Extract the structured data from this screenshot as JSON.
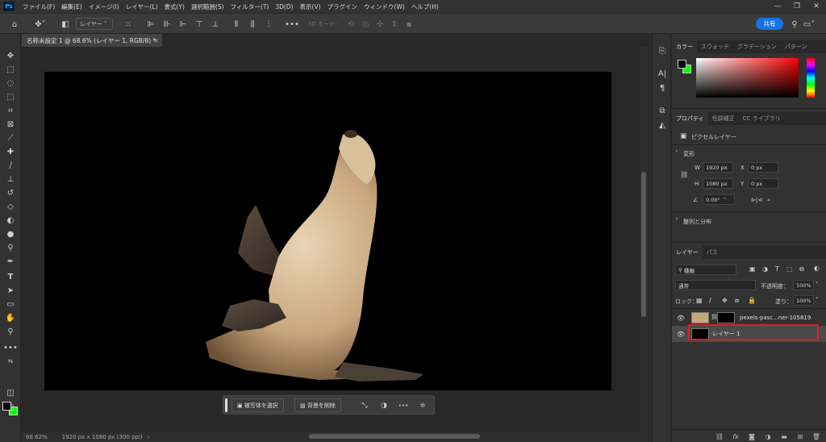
{
  "app": {
    "logo": "Ps"
  },
  "menu": [
    "ファイル(F)",
    "編集(E)",
    "イメージ(I)",
    "レイヤー(L)",
    "書式(Y)",
    "選択範囲(S)",
    "フィルター(T)",
    "3D(D)",
    "表示(V)",
    "プラグイン",
    "ウィンドウ(W)",
    "ヘルプ(H)"
  ],
  "options_bar": {
    "auto_select_value": "レイヤー",
    "mode_3d_label": "3D モード：",
    "share_label": "共有"
  },
  "document": {
    "tab_title": "名称未設定 1 @ 68.6% (レイヤー 1, RGB/8) *",
    "zoom": "68.62%",
    "info": "1920 px x 1080 px (300 ppi)"
  },
  "context_bar": {
    "select_subject": "被写体を選択",
    "remove_background": "背景を削除",
    "more": "•••"
  },
  "color_panel": {
    "tabs": [
      "カラー",
      "スウォッチ",
      "グラデーション",
      "パターン"
    ],
    "foreground": "#000000",
    "background": "#00ff00"
  },
  "properties_panel": {
    "tabs": [
      "プロパティ",
      "色調補正",
      "CC ライブラリ"
    ],
    "layer_type": "ピクセルレイヤー",
    "transform_label": "変形",
    "w_label": "W",
    "w_value": "1920 px",
    "h_label": "H",
    "h_value": "1080 px",
    "x_label": "X",
    "x_value": "0 px",
    "y_label": "Y",
    "y_value": "0 px",
    "angle_value": "0.00°",
    "align_label": "整列と分布"
  },
  "layers_panel": {
    "tabs": [
      "レイヤー",
      "パス"
    ],
    "filter_label": "種類",
    "blend_mode": "通常",
    "opacity_label": "不透明度：",
    "opacity_value": "100%",
    "lock_label": "ロック：",
    "fill_label": "塗り：",
    "fill_value": "100%",
    "layers": [
      {
        "name": "pexels-pasc...ner-105819",
        "selected": false
      },
      {
        "name": "レイヤー 1",
        "selected": true
      }
    ]
  }
}
